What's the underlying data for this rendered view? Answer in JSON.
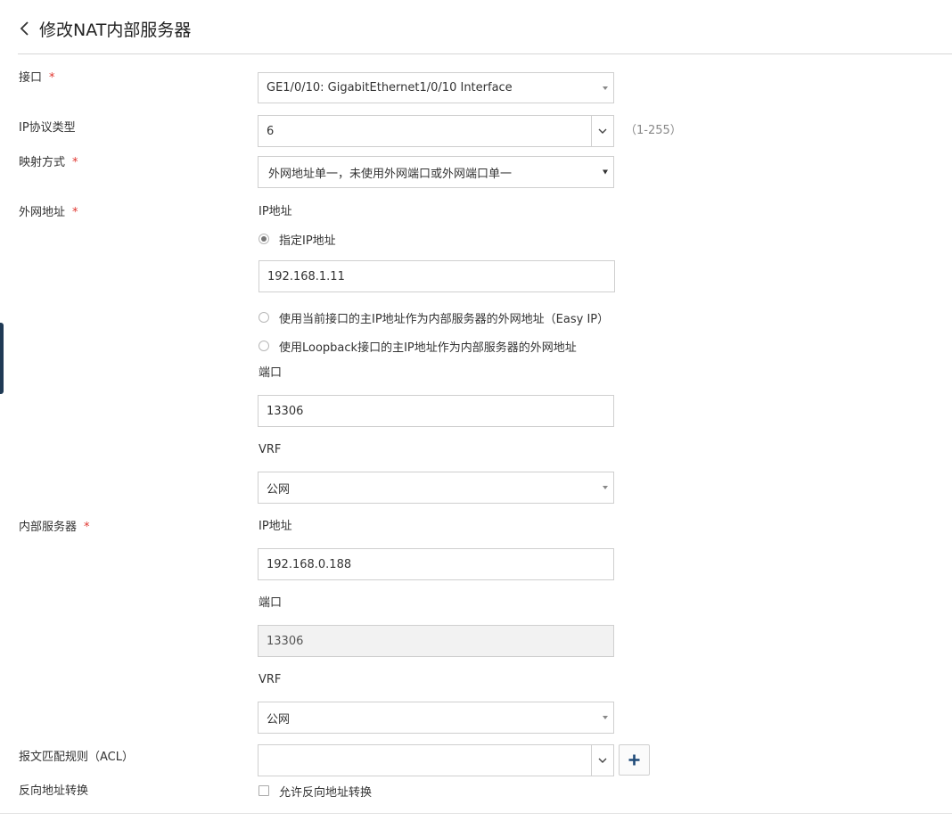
{
  "header": {
    "title": "修改NAT内部服务器",
    "back_icon": "chevron-left-icon"
  },
  "form": {
    "interface": {
      "label": "接口",
      "required_mark": "*",
      "value": "GE1/0/10: GigabitEthernet1/0/10 Interface"
    },
    "ip_protocol": {
      "label": "IP协议类型",
      "value": "6",
      "hint": "（1-255）"
    },
    "mapping_mode": {
      "label": "映射方式",
      "required_mark": "*",
      "value": "外网地址单一，未使用外网端口或外网端口单一"
    },
    "external_address": {
      "label": "外网地址",
      "required_mark": "*",
      "ip_label": "IP地址",
      "options": [
        "指定IP地址",
        "使用当前接口的主IP地址作为内部服务器的外网地址（Easy IP）",
        "使用Loopback接口的主IP地址作为内部服务器的外网地址"
      ],
      "selected_option": 0,
      "ip_value": "192.168.1.11",
      "port_label": "端口",
      "port_value": "13306",
      "vrf_label": "VRF",
      "vrf_value": "公网"
    },
    "internal_server": {
      "label": "内部服务器",
      "required_mark": "*",
      "ip_label": "IP地址",
      "ip_value": "192.168.0.188",
      "port_label": "端口",
      "port_value": "13306",
      "vrf_label": "VRF",
      "vrf_value": "公网"
    },
    "acl": {
      "label": "报文匹配规则（ACL）",
      "value": "",
      "add_icon": "plus-icon"
    },
    "reverse_translation": {
      "label": "反向地址转换",
      "checkbox_label": "允许反向地址转换",
      "checked": false
    }
  },
  "colors": {
    "required": "#e0342e",
    "accent": "#1f4a78",
    "border": "#cfcfcf"
  }
}
